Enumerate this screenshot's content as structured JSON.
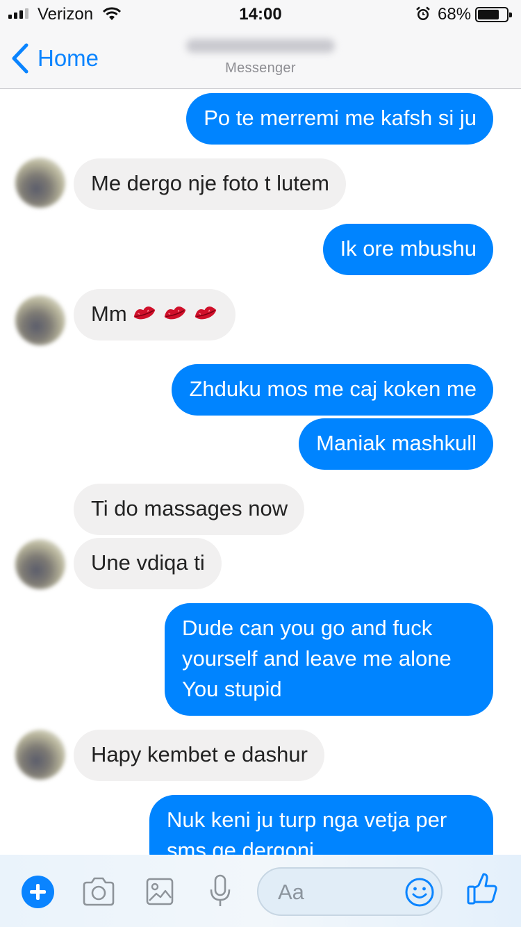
{
  "status_bar": {
    "carrier": "Verizon",
    "time": "14:00",
    "battery_percent": "68%",
    "battery_level": 0.68,
    "icons": [
      "signal-icon",
      "wifi-icon",
      "alarm-icon",
      "battery-icon"
    ]
  },
  "nav": {
    "back_label": "Home",
    "subtitle": "Messenger"
  },
  "messages": [
    {
      "sender": "me",
      "text": "Po te merremi me kafsh si ju"
    },
    {
      "sender": "them",
      "text": "Me dergo nje foto t lutem"
    },
    {
      "sender": "me",
      "text": "Ik ore mbushu"
    },
    {
      "sender": "them",
      "text": "Mm",
      "emoji": [
        "kiss-mark",
        "kiss-mark",
        "kiss-mark"
      ]
    },
    {
      "sender": "me",
      "text": "Zhduku mos me caj koken me"
    },
    {
      "sender": "me",
      "text": "Maniak mashkull"
    },
    {
      "sender": "them",
      "text": "Ti do massages now"
    },
    {
      "sender": "them",
      "text": "Une vdiqa ti"
    },
    {
      "sender": "me",
      "text": "Dude can you go and fuck yourself and leave me alone You stupid"
    },
    {
      "sender": "them",
      "text": "Hapy kembet e dashur"
    },
    {
      "sender": "me",
      "text": "Nuk keni ju turp nga vetja per sms qe dergoni"
    }
  ],
  "composer": {
    "placeholder": "Aa",
    "icons": [
      "plus-icon",
      "camera-icon",
      "gallery-icon",
      "microphone-icon",
      "smiley-icon",
      "thumbs-up-icon"
    ]
  },
  "colors": {
    "accent": "#0084ff",
    "incoming_bubble": "#f1f0f0",
    "outgoing_text": "#ffffff"
  }
}
